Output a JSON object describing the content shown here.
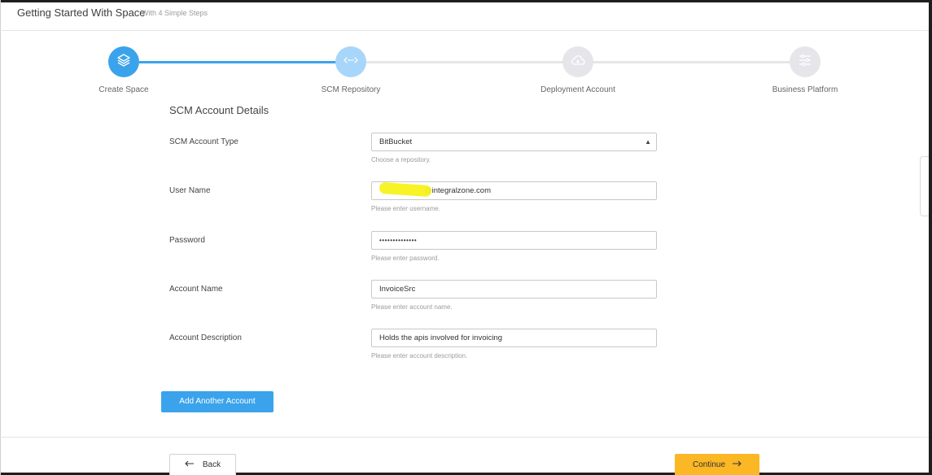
{
  "header": {
    "title": "Getting Started With Space",
    "subtitle": "With 4 Simple Steps"
  },
  "steps": [
    {
      "label": "Create Space",
      "icon": "layers-icon",
      "status": "complete"
    },
    {
      "label": "SCM Repository",
      "icon": "code-arrows-icon",
      "status": "active"
    },
    {
      "label": "Deployment Account",
      "icon": "cloud-icon",
      "status": "pending"
    },
    {
      "label": "Business Platform",
      "icon": "sliders-icon",
      "status": "pending"
    }
  ],
  "form": {
    "section_title": "SCM Account Details",
    "account_type": {
      "label": "SCM Account Type",
      "value": "BitBucket",
      "help": "Choose a repository."
    },
    "user_name": {
      "label": "User Name",
      "value": "frank.thomas@integralzone.com",
      "visible_suffix": "@integralzone.com",
      "help": "Please enter username."
    },
    "password": {
      "label": "Password",
      "value": "••••••••••••••",
      "help": "Please enter password."
    },
    "account_name": {
      "label": "Account Name",
      "value": "InvoiceSrc",
      "help": "Please enter account name."
    },
    "account_description": {
      "label": "Account Description",
      "value": "Holds the apis involved for invoicing",
      "help": "Please enter account description."
    }
  },
  "buttons": {
    "add_account": "Add Another Account",
    "back": "Back",
    "continue": "Continue"
  },
  "colors": {
    "complete": "#3aa3ec",
    "active": "#a8d6fa",
    "pending": "#e6e6ea",
    "continue": "#fbb724",
    "highlight": "#f7f21a"
  }
}
